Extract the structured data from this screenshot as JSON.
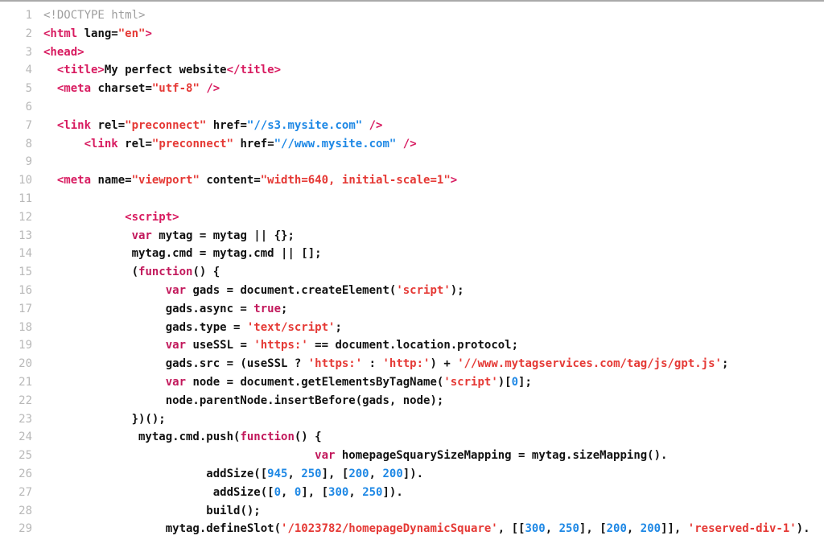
{
  "gutter": [
    "1",
    "2",
    "3",
    "4",
    "5",
    "6",
    "7",
    "8",
    "9",
    "10",
    "11",
    "12",
    "13",
    "14",
    "15",
    "16",
    "17",
    "18",
    "19",
    "20",
    "21",
    "22",
    "23",
    "24",
    "25",
    "26",
    "27",
    "28",
    "29"
  ],
  "code": {
    "doctype": "<!DOCTYPE html>",
    "html_open_1": "<html",
    "html_lang_attr": " lang=",
    "html_lang_val": "\"en\"",
    "html_open_2": ">",
    "head_open": "<head>",
    "title_open": "<title>",
    "title_text": "My perfect website",
    "title_close": "</title>",
    "meta_charset_1": "<meta",
    "meta_charset_attr": " charset=",
    "meta_charset_val": "\"utf-8\"",
    "meta_charset_2": " />",
    "link1_1": "<link",
    "link1_rel_attr": " rel=",
    "link1_rel_val": "\"preconnect\"",
    "link1_href_attr": " href=",
    "link1_href_val": "\"//s3.mysite.com\"",
    "link1_2": " />",
    "link2_1": "<link",
    "link2_rel_attr": " rel=",
    "link2_rel_val": "\"preconnect\"",
    "link2_href_attr": " href=",
    "link2_href_val": "\"//www.mysite.com\"",
    "link2_2": " />",
    "meta_vp_1": "<meta",
    "meta_vp_name_attr": " name=",
    "meta_vp_name_val": "\"viewport\"",
    "meta_vp_cont_attr": " content=",
    "meta_vp_cont_val": "\"width=640, initial-scale=1\"",
    "meta_vp_2": ">",
    "script_open": "<script>",
    "l13_var": "var",
    "l13_rest": " mytag = mytag || {};",
    "l14": "mytag.cmd = mytag.cmd || [];",
    "l15_a": "(",
    "l15_fn": "function",
    "l15_b": "() {",
    "l16_var": "var",
    "l16_mid": " gads = document.createElement(",
    "l16_str": "'script'",
    "l16_end": ");",
    "l17_a": "gads.async = ",
    "l17_true": "true",
    "l17_b": ";",
    "l18_a": "gads.type = ",
    "l18_str": "'text/script'",
    "l18_b": ";",
    "l19_var": "var",
    "l19_a": " useSSL = ",
    "l19_str": "'https:'",
    "l19_b": " == document.location.protocol;",
    "l20_a": "gads.src = (useSSL ? ",
    "l20_s1": "'https:'",
    "l20_b": " : ",
    "l20_s2": "'http:'",
    "l20_c": ") + ",
    "l20_s3": "'//www.mytagservices.com/tag/js/gpt.js'",
    "l20_d": ";",
    "l21_var": "var",
    "l21_a": " node = document.getElementsByTagName(",
    "l21_str": "'script'",
    "l21_b": ")[",
    "l21_num": "0",
    "l21_c": "];",
    "l22": "node.parentNode.insertBefore(gads, node);",
    "l23": "})();",
    "l24_a": " mytag.cmd.push(",
    "l24_fn": "function",
    "l24_b": "() {",
    "l25_var": "var",
    "l25_rest": " homepageSquarySizeMapping = mytag.sizeMapping().",
    "l26_a": "addSize([",
    "l26_n1": "945",
    "l26_c1": ", ",
    "l26_n2": "250",
    "l26_b": "], [",
    "l26_n3": "200",
    "l26_c2": ", ",
    "l26_n4": "200",
    "l26_c": "]).",
    "l27_a": " addSize([",
    "l27_n1": "0",
    "l27_c1": ", ",
    "l27_n2": "0",
    "l27_b": "], [",
    "l27_n3": "300",
    "l27_c2": ", ",
    "l27_n4": "250",
    "l27_c": "]).",
    "l28": "build();",
    "l29_a": "mytag.defineSlot(",
    "l29_s1": "'/1023782/homepageDynamicSquare'",
    "l29_b": ", [[",
    "l29_n1": "300",
    "l29_c1": ", ",
    "l29_n2": "250",
    "l29_c": "], [",
    "l29_n3": "200",
    "l29_c2": ", ",
    "l29_n4": "200",
    "l29_d": "]], ",
    "l29_s2": "'reserved-div-1'",
    "l29_e": ")."
  },
  "indent": {
    "i2": "  ",
    "i6": "      ",
    "i12": "             ",
    "i13": "            ",
    "i18": "                  ",
    "i22": "                        ",
    "i24": "                          ",
    "i38": "                                        "
  }
}
